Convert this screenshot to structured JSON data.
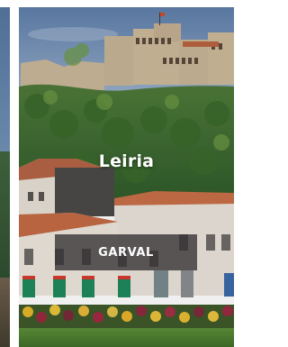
{
  "carousel": {
    "card": {
      "city": "Leiria",
      "label": "GARVAL",
      "image_subject": "castle-town-photo"
    }
  },
  "colors": {
    "sky": "#6f8db6",
    "label_background": "#343032",
    "title_text": "#ffffff"
  }
}
